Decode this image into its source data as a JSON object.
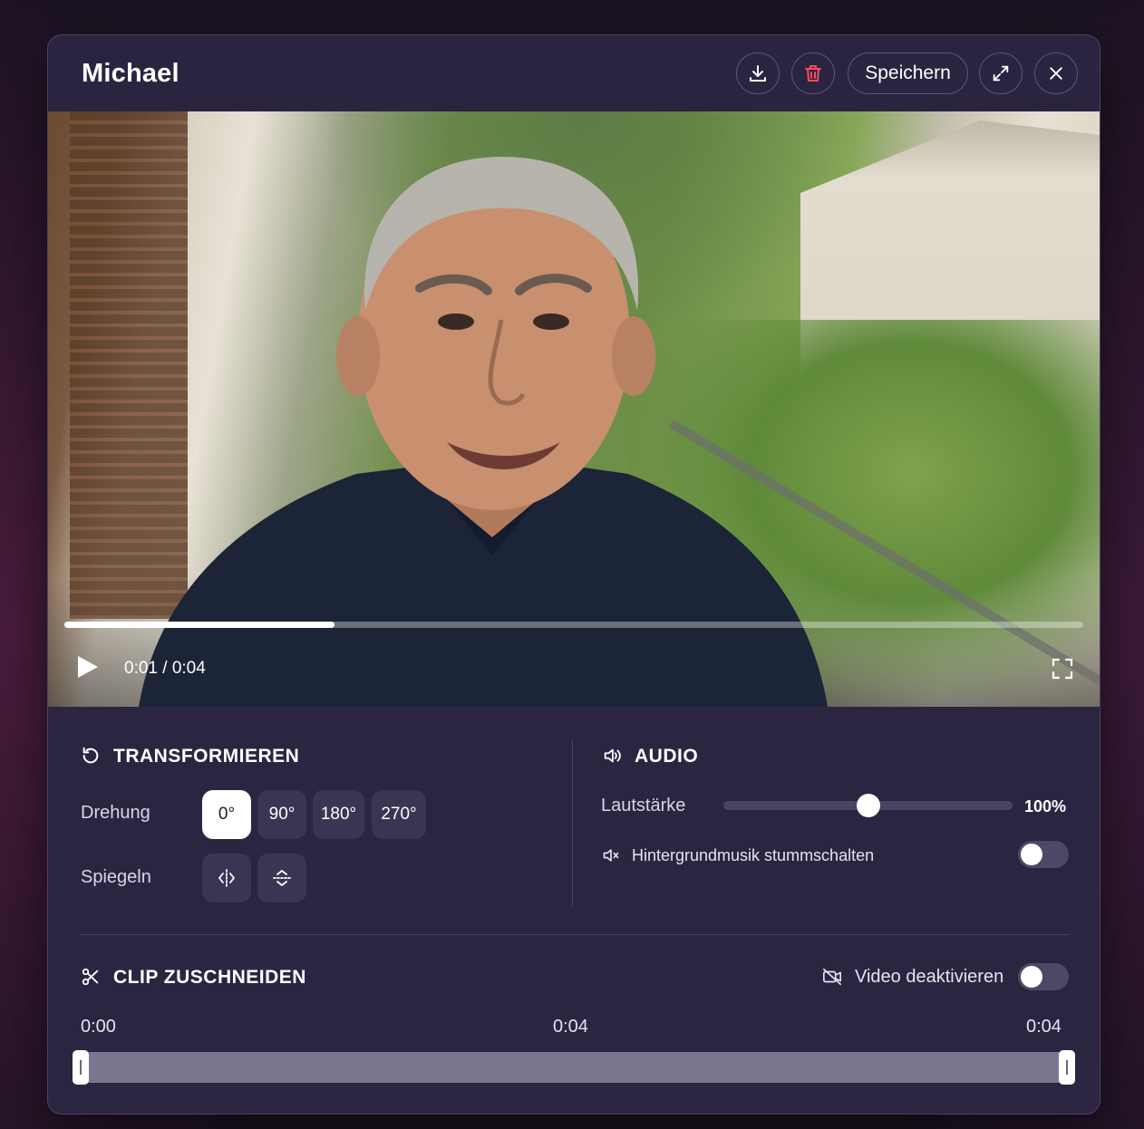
{
  "header": {
    "title": "Michael",
    "save_label": "Speichern"
  },
  "player": {
    "time": "0:01 / 0:04",
    "progress": 0.265
  },
  "transform": {
    "title": "TRANSFORMIEREN",
    "rotation_label": "Drehung",
    "rotation_options": [
      "0°",
      "90°",
      "180°",
      "270°"
    ],
    "rotation_selected": "0°",
    "mirror_label": "Spiegeln"
  },
  "audio": {
    "title": "AUDIO",
    "volume_label": "Lautstärke",
    "volume_value": "100%",
    "volume_level": 0.5,
    "mute_music_label": "Hintergrundmusik stummschalten",
    "mute_music_on": false
  },
  "clip": {
    "title": "CLIP ZUSCHNEIDEN",
    "disable_video_label": "Video deaktivieren",
    "disable_video_on": false,
    "start_time": "0:00",
    "duration": "0:04",
    "end_time": "0:04",
    "trim_start": 0.0,
    "trim_end": 1.0
  },
  "colors": {
    "panel": "#2c2542",
    "accent_delete": "#ff4d57",
    "chip": "#3b3553"
  }
}
